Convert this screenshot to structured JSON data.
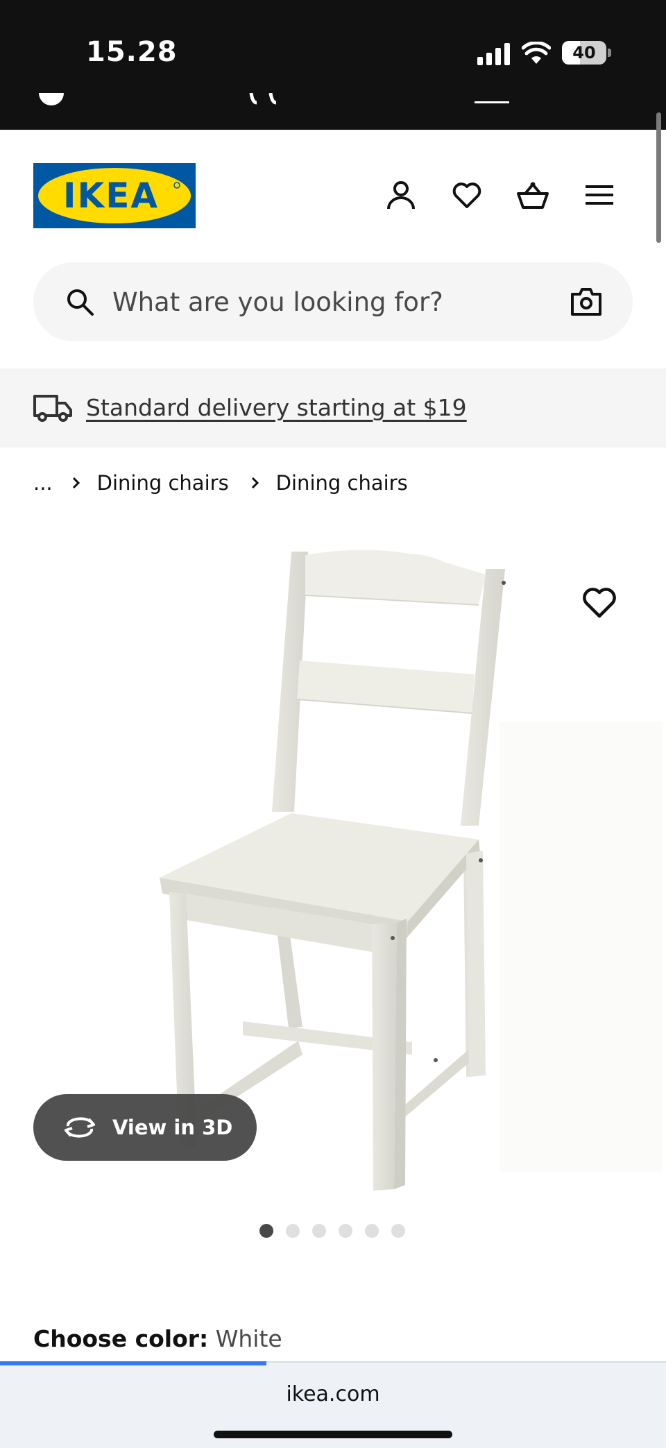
{
  "status_bar": {
    "time": "15.28",
    "battery_level": 40,
    "battery_label": "40"
  },
  "header": {
    "logo_text": "IKEA",
    "icons": [
      "profile-icon",
      "heart-icon",
      "shopping-basket-icon",
      "menu-icon"
    ]
  },
  "search": {
    "placeholder": "What are you looking for?"
  },
  "delivery": {
    "text": "Standard delivery starting at $19"
  },
  "breadcrumb": {
    "items": [
      "...",
      "Dining chairs",
      "Dining chairs"
    ]
  },
  "gallery": {
    "view_3d_label": "View in 3D",
    "image_count": 6,
    "active_index": 0
  },
  "product": {
    "color_label": "Choose color:",
    "color_value": "White"
  },
  "browser": {
    "url": "ikea.com",
    "load_progress": 0.4
  },
  "colors": {
    "ikea_blue": "#0058a3",
    "ikea_yellow": "#ffdb00",
    "text_primary": "#111111",
    "surface_grey": "#f5f5f5",
    "pill_dark": "#484848"
  }
}
